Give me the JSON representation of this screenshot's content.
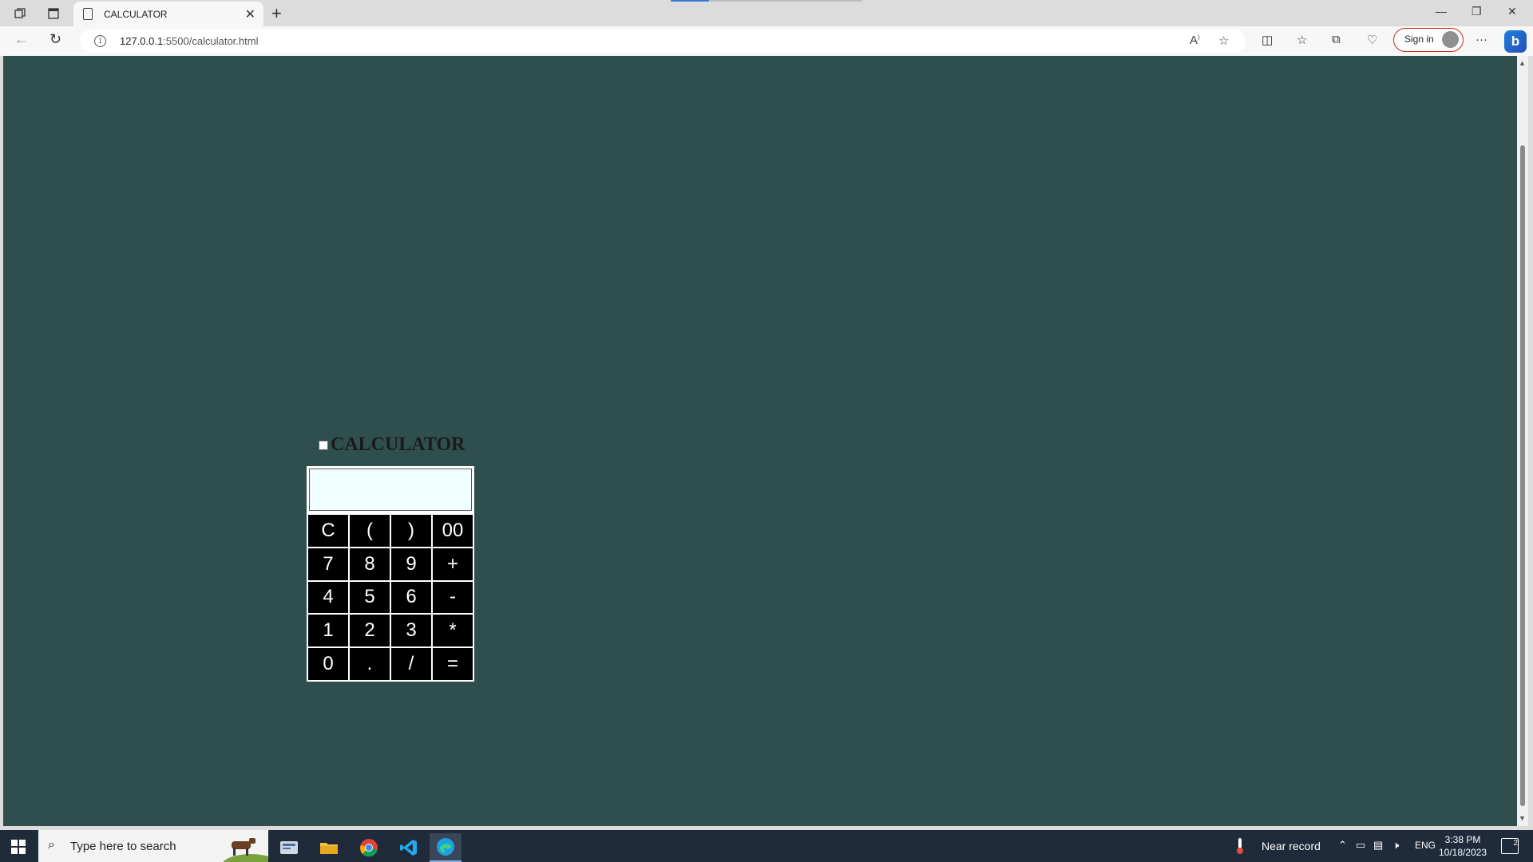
{
  "browser": {
    "tab_title": "CALCULATOR",
    "url_host": "127.0.0.1",
    "url_path": ":5500/calculator.html",
    "signin_label": "Sign in"
  },
  "page": {
    "background": "#2f4f4f",
    "calculator": {
      "title": "CALCULATOR",
      "display_value": "",
      "display_background": "#f0ffff",
      "keys": [
        "C",
        "(",
        ")",
        "00",
        "7",
        "8",
        "9",
        "+",
        "4",
        "5",
        "6",
        "-",
        "1",
        "2",
        "3",
        "*",
        "0",
        ".",
        "/",
        "="
      ]
    }
  },
  "taskbar": {
    "search_placeholder": "Type here to search",
    "weather": "Near record",
    "language": "ENG",
    "time": "3:38 PM",
    "date": "10/18/2023",
    "notifications": "2"
  }
}
